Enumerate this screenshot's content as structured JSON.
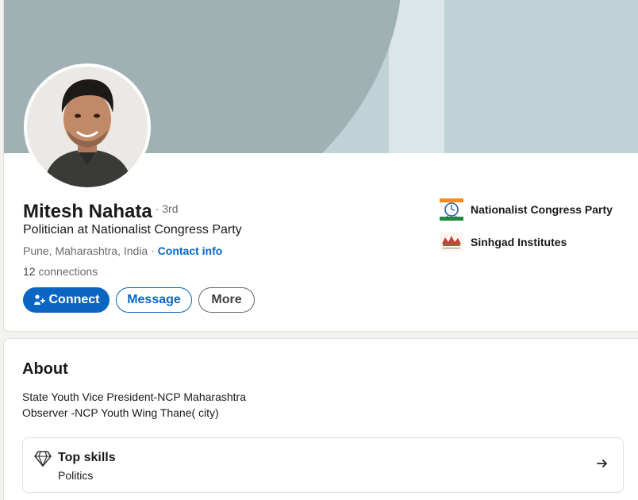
{
  "profile": {
    "name": "Mitesh Nahata",
    "degree": "· 3rd",
    "headline": "Politician at Nationalist Congress Party",
    "location": "Pune, Maharashtra, India",
    "separator": " · ",
    "contact_info": "Contact info",
    "connections_count": "12",
    "connections_label": " connections"
  },
  "actions": {
    "connect": "Connect",
    "message": "Message",
    "more": "More"
  },
  "organizations": [
    {
      "name": "Nationalist Congress Party",
      "icon": "ncp-clock-logo"
    },
    {
      "name": "Sinhgad Institutes",
      "icon": "sinhgad-logo"
    }
  ],
  "about": {
    "title": "About",
    "lines": [
      "State Youth Vice President-NCP Maharashtra",
      "Observer -NCP Youth Wing Thane( city)"
    ]
  },
  "top_skills": {
    "title": "Top skills",
    "skills": "Politics"
  },
  "colors": {
    "accent": "#0a66c2",
    "banner_light": "#bfd3d6",
    "banner_dark": "#a0b1b4"
  }
}
